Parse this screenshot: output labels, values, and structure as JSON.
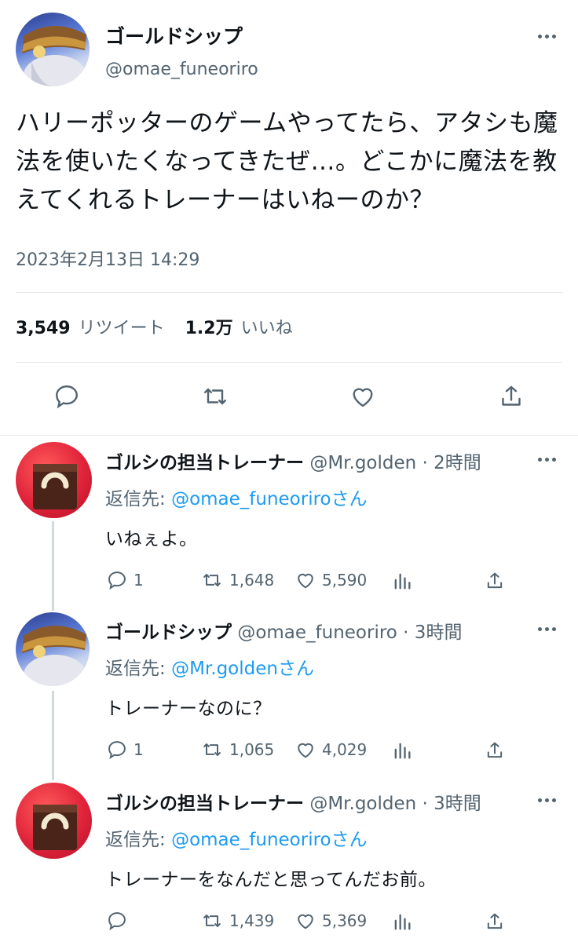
{
  "main_tweet": {
    "display_name": "ゴールドシップ",
    "handle": "@omae_funeoriro",
    "text": "ハリーポッターのゲームやってたら、アタシも魔法を使いたくなってきたぜ…。どこかに魔法を教えてくれるトレーナーはいねーのか？",
    "timestamp": "2023年2月13日 14:29",
    "retweets_count": "3,549",
    "retweets_label": "リツイート",
    "likes_count": "1.2万",
    "likes_label": "いいね"
  },
  "replies": [
    {
      "display_name": "ゴルシの担当トレーナー",
      "meta": "@Mr.golden · 2時間",
      "reply_prefix": "返信先: ",
      "reply_to": "@omae_funeoriroさん",
      "text": "いねぇよ。",
      "replies_count": "1",
      "retweets_count": "1,648",
      "likes_count": "5,590"
    },
    {
      "display_name": "ゴールドシップ",
      "meta": "@omae_funeoriro · 3時間",
      "reply_prefix": "返信先: ",
      "reply_to": "@Mr.goldenさん",
      "text": "トレーナーなのに？",
      "replies_count": "1",
      "retweets_count": "1,065",
      "likes_count": "4,029"
    },
    {
      "display_name": "ゴルシの担当トレーナー",
      "meta": "@Mr.golden · 3時間",
      "reply_prefix": "返信先: ",
      "reply_to": "@omae_funeoriroさん",
      "text": "トレーナーをなんだと思ってんだお前。",
      "replies_count": "",
      "retweets_count": "1,439",
      "likes_count": "5,369"
    }
  ],
  "icons": [
    "more-icon",
    "reply-icon",
    "retweet-icon",
    "like-icon",
    "share-icon",
    "analytics-icon"
  ],
  "colors": {
    "accent": "#1d9bf0",
    "muted": "#536471",
    "divider": "#e5e8eb",
    "text": "#0f1419"
  }
}
